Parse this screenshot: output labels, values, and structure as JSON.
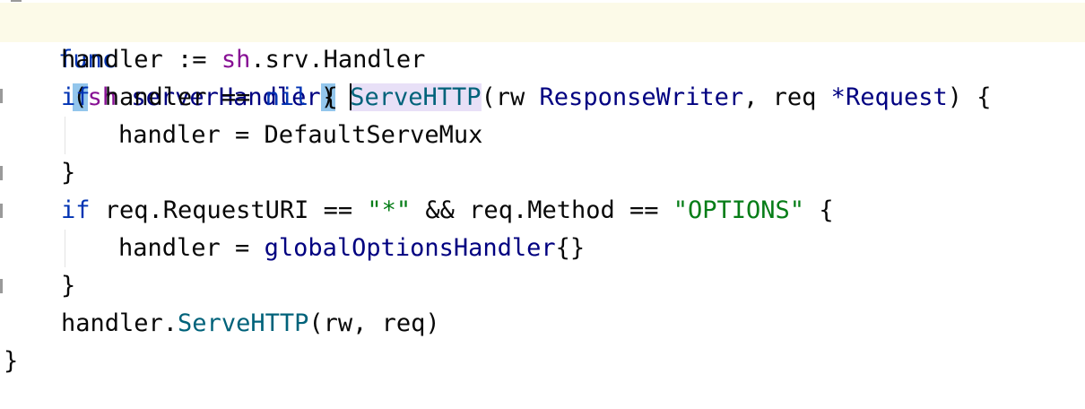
{
  "code": {
    "line1": {
      "kw_func": "func",
      "open_paren": "(",
      "receiver_name": "sh",
      "receiver_space": " ",
      "receiver_type": "serverHandler",
      "close_paren": ")",
      "space": " ",
      "method_name": "ServeHTTP",
      "params_open": "(rw ",
      "param_type1": "ResponseWriter",
      "params_mid": ", req ",
      "param_ptr": "*",
      "param_type2": "Request",
      "params_close": ") {"
    },
    "line2": {
      "lhs": "handler := ",
      "recv": "sh",
      "rest": ".srv.Handler"
    },
    "line3": {
      "kw_if": "if",
      "cond": " handler == ",
      "nil": "nil",
      "brace": " {"
    },
    "line4": {
      "text": "handler = DefaultServeMux"
    },
    "line5": {
      "text": "}"
    },
    "line6": {
      "kw_if": "if",
      "cond1": " req.RequestURI == ",
      "str1": "\"*\"",
      "mid": " && req.Method == ",
      "str2": "\"OPTIONS\"",
      "brace": " {"
    },
    "line7": {
      "lhs": "handler = ",
      "type": "globalOptionsHandler",
      "rest": "{}"
    },
    "line8": {
      "text": "}"
    },
    "line9": {
      "obj": "handler.",
      "call": "ServeHTTP",
      "args": "(rw, req)"
    },
    "line10": {
      "text": "}"
    }
  },
  "colors": {
    "keyword": "#0033b3",
    "type": "#000080",
    "string": "#067d17",
    "receiver": "#871094",
    "function_call": "#00627a",
    "current_line": "#fcfae8",
    "paren_highlight": "#93c6ec",
    "identifier_highlight": "#e8e0f7"
  }
}
